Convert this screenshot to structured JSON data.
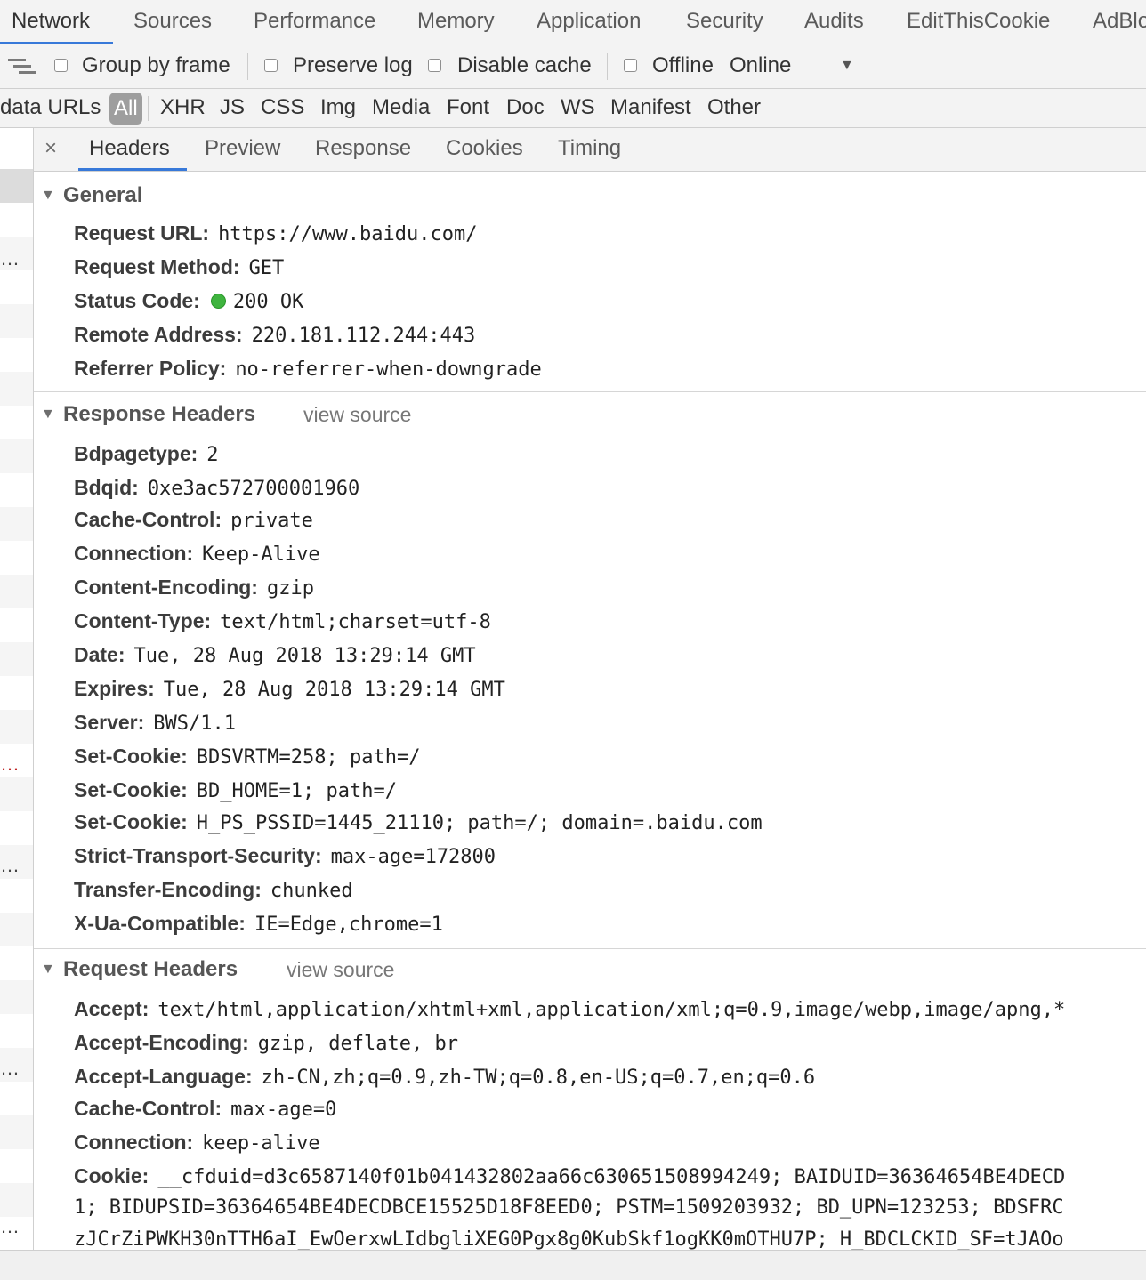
{
  "tabs": [
    "Network",
    "Sources",
    "Performance",
    "Memory",
    "Application",
    "Security",
    "Audits",
    "EditThisCookie",
    "AdBlo"
  ],
  "toolbar": {
    "group_by_frame": "Group by frame",
    "preserve_log": "Preserve log",
    "disable_cache": "Disable cache",
    "offline": "Offline",
    "throttle": "Online",
    "dropdown_arrow": "▼"
  },
  "filters": {
    "data_urls": "data URLs",
    "types": [
      "All",
      "XHR",
      "JS",
      "CSS",
      "Img",
      "Media",
      "Font",
      "Doc",
      "WS",
      "Manifest",
      "Other"
    ]
  },
  "detail": {
    "close": "×",
    "tabs": [
      "Headers",
      "Preview",
      "Response",
      "Cookies",
      "Timing"
    ]
  },
  "general": {
    "title": "General",
    "rows": [
      {
        "key": "Request URL:",
        "value": "https://www.baidu.com/"
      },
      {
        "key": "Request Method:",
        "value": "GET"
      },
      {
        "key": "Status Code:",
        "value": "200 OK"
      },
      {
        "key": "Remote Address:",
        "value": "220.181.112.244:443"
      },
      {
        "key": "Referrer Policy:",
        "value": "no-referrer-when-downgrade"
      }
    ]
  },
  "response_headers": {
    "title": "Response Headers",
    "view_source": "view source",
    "rows": [
      {
        "key": "Bdpagetype:",
        "value": "2"
      },
      {
        "key": "Bdqid:",
        "value": "0xe3ac572700001960"
      },
      {
        "key": "Cache-Control:",
        "value": "private"
      },
      {
        "key": "Connection:",
        "value": "Keep-Alive"
      },
      {
        "key": "Content-Encoding:",
        "value": "gzip"
      },
      {
        "key": "Content-Type:",
        "value": "text/html;charset=utf-8"
      },
      {
        "key": "Date:",
        "value": "Tue, 28 Aug 2018 13:29:14 GMT"
      },
      {
        "key": "Expires:",
        "value": "Tue, 28 Aug 2018 13:29:14 GMT"
      },
      {
        "key": "Server:",
        "value": "BWS/1.1"
      },
      {
        "key": "Set-Cookie:",
        "value": "BDSVRTM=258; path=/"
      },
      {
        "key": "Set-Cookie:",
        "value": "BD_HOME=1; path=/"
      },
      {
        "key": "Set-Cookie:",
        "value": "H_PS_PSSID=1445_21110; path=/; domain=.baidu.com"
      },
      {
        "key": "Strict-Transport-Security:",
        "value": "max-age=172800"
      },
      {
        "key": "Transfer-Encoding:",
        "value": "chunked"
      },
      {
        "key": "X-Ua-Compatible:",
        "value": "IE=Edge,chrome=1"
      }
    ]
  },
  "request_headers": {
    "title": "Request Headers",
    "view_source": "view source",
    "rows": [
      {
        "key": "Accept:",
        "value": "text/html,application/xhtml+xml,application/xml;q=0.9,image/webp,image/apng,*"
      },
      {
        "key": "Accept-Encoding:",
        "value": "gzip, deflate, br"
      },
      {
        "key": "Accept-Language:",
        "value": "zh-CN,zh;q=0.9,zh-TW;q=0.8,en-US;q=0.7,en;q=0.6"
      },
      {
        "key": "Cache-Control:",
        "value": "max-age=0"
      },
      {
        "key": "Connection:",
        "value": "keep-alive"
      },
      {
        "key": "Cookie:",
        "value": "__cfduid=d3c6587140f01b041432802aa66c630651508994249; BAIDUID=36364654BE4DECD"
      }
    ],
    "cookie_continuation": [
      "1; BIDUPSID=36364654BE4DECDBCE15525D18F8EED0; PSTM=1509203932; BD_UPN=123253; BDSFRC",
      "zJCrZiPWKH30nTTH6aI_EwOerxwLIdbgliXEG0Pgx8g0KubSkf1ogKK0mOTHU7P; H_BDCLCKID_SF=tJAOo"
    ]
  },
  "left_strip": {
    "ellipses": [
      "…",
      "…",
      "…",
      "…",
      "…",
      "…"
    ]
  }
}
